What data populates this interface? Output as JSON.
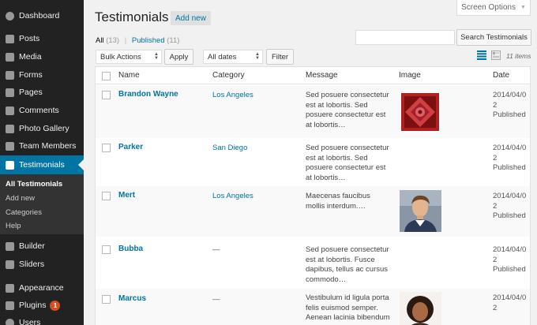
{
  "sidebar": {
    "items": [
      {
        "label": "Dashboard"
      },
      {
        "label": "Posts"
      },
      {
        "label": "Media"
      },
      {
        "label": "Forms"
      },
      {
        "label": "Pages"
      },
      {
        "label": "Comments"
      },
      {
        "label": "Photo Gallery"
      },
      {
        "label": "Team Members"
      },
      {
        "label": "Testimonials"
      },
      {
        "label": "Builder"
      },
      {
        "label": "Sliders"
      },
      {
        "label": "Appearance"
      },
      {
        "label": "Plugins",
        "badge": "1"
      },
      {
        "label": "Users"
      }
    ],
    "submenu": [
      {
        "label": "All Testimonials"
      },
      {
        "label": "Add new"
      },
      {
        "label": "Categories"
      },
      {
        "label": "Help"
      }
    ]
  },
  "header": {
    "screen_options": "Screen Options",
    "title": "Testimonials",
    "add_new": "Add new"
  },
  "filters": {
    "all": "All",
    "all_count": "(13)",
    "separator": "|",
    "published": "Published",
    "published_count": "(11)"
  },
  "search": {
    "placeholder": "",
    "button": "Search Testimonials"
  },
  "actions": {
    "bulk": "Bulk Actions",
    "apply": "Apply",
    "dates": "All dates",
    "filter": "Filter",
    "items_count": "11 items"
  },
  "table": {
    "columns": [
      "Name",
      "Category",
      "Message",
      "Image",
      "Date"
    ],
    "rows": [
      {
        "name": "Brandon Wayne",
        "category": "Los Angeles",
        "message": "Sed posuere consectetur est at lobortis. Sed posuere consectetur est at lobortis…",
        "image": "ornament",
        "date": "2014/04/0 2",
        "status": "Published"
      },
      {
        "name": "Parker",
        "category": "San Diego",
        "message": "Sed posuere consectetur est at lobortis. Sed posuere consectetur est at lobortis…",
        "image": "",
        "date": "2014/04/0 2",
        "status": "Published"
      },
      {
        "name": "Mert",
        "category": "Los Angeles",
        "message": "Maecenas faucibus mollis interdum.…",
        "image": "man-portrait",
        "date": "2014/04/0 2",
        "status": "Published"
      },
      {
        "name": "Bubba",
        "category": "—",
        "message": "Sed posuere consectetur est at lobortis. Fusce dapibus, tellus ac cursus commodo…",
        "image": "",
        "date": "2014/04/0 2",
        "status": "Published"
      },
      {
        "name": "Marcus",
        "category": "—",
        "message": "Vestibulum id ligula porta felis euismod semper. Aenean lacinia bibendum",
        "image": "woman-portrait",
        "date": "2014/04/0 2",
        "status": ""
      }
    ]
  },
  "colors": {
    "sidebar_bg": "#222222",
    "accent": "#0074a2",
    "badge": "#d54e21"
  }
}
